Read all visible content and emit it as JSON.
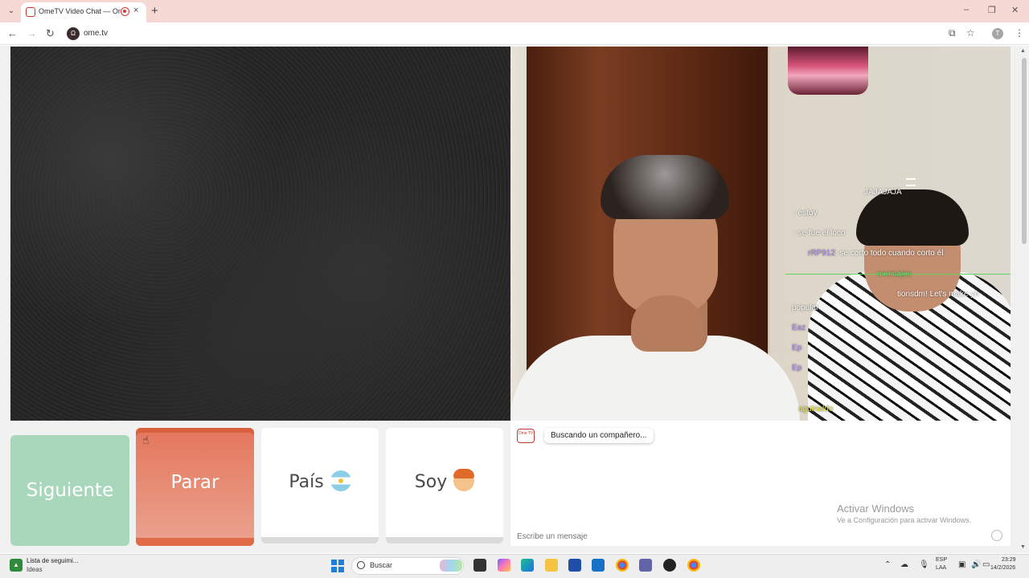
{
  "browser": {
    "tab_title": "OmeTV Video Chat — Ome",
    "tab_close": "×",
    "new_tab": "+",
    "url": "ome.tv",
    "profile_initial": "T",
    "window_controls": {
      "minimize": "–",
      "restore": "❐",
      "close": "✕"
    }
  },
  "overlay_chat": {
    "lines": [
      {
        "user": "",
        "text": "JAJAJAJA"
      },
      {
        "user": "",
        "text": ": estoy"
      },
      {
        "user": "",
        "text": ": se fue el loco"
      },
      {
        "user": "rRP912",
        "text": ": se corto todo cuando corto él"
      },
      {
        "user": "",
        "text": "mensajes"
      },
      {
        "user": "",
        "text": "tionsdm! Let's make yo"
      },
      {
        "user": "",
        "text": "popular"
      },
      {
        "user": "Eaz",
        "text": ""
      },
      {
        "user": "Ep",
        "text": ""
      },
      {
        "user": "Ep",
        "text": ""
      },
      {
        "user": "",
        "text": "aguinaldo"
      }
    ]
  },
  "controls": {
    "next_label": "Siguiente",
    "stop_label": "Parar",
    "country_label": "País",
    "soy_label": "Soy"
  },
  "chat": {
    "logo_text": "Ome TV",
    "status_message": "Buscando un compañero...",
    "input_placeholder": "Escribe un mensaje"
  },
  "watermark": {
    "title": "Activar Windows",
    "subtitle": "Ve a Configuración para activar Windows."
  },
  "taskbar": {
    "widget_title": "Lista de seguimi...",
    "widget_subtitle": "Ideas",
    "search_placeholder": "Buscar",
    "lang_line1": "ESP",
    "lang_line2": "LAA",
    "time": "23:29",
    "date": "14/2/2026"
  },
  "colors": {
    "next": "#a9d7bb",
    "stop": "#e4765c",
    "tabbar": "#f6d9d5",
    "overlay_username": "#a987e8",
    "overlay_highlight": "#6fe06f"
  }
}
